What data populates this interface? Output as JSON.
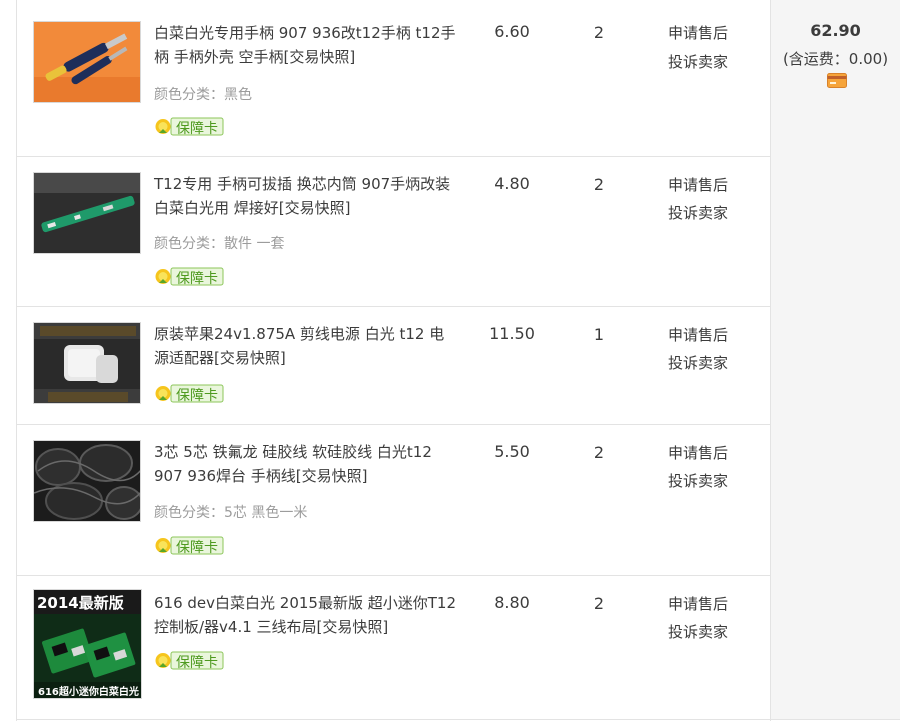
{
  "order": {
    "total": "62.90",
    "shipping": "(含运费：0.00)",
    "items": [
      {
        "title": "白菜白光专用手柄 907 936改t12手柄 t12手柄 手柄外壳 空手柄[交易快照]",
        "spec": "颜色分类：黑色",
        "price": "6.60",
        "qty": "2",
        "action_after_sale": "申请售后",
        "action_complain": "投诉卖家",
        "badge": "保障卡",
        "thumb_icon": "handle-product-icon"
      },
      {
        "title": "T12专用 手柄可拔插 换芯内筒 907手炳改装白菜白光用 焊接好[交易快照]",
        "spec": "颜色分类：散件 一套",
        "price": "4.80",
        "qty": "2",
        "action_after_sale": "申请售后",
        "action_complain": "投诉卖家",
        "badge": "保障卡",
        "thumb_icon": "circuit-tube-product-icon"
      },
      {
        "title": "原装苹果24v1.875A 剪线电源 白光 t12 电源适配器[交易快照]",
        "spec": "",
        "price": "11.50",
        "qty": "1",
        "action_after_sale": "申请售后",
        "action_complain": "投诉卖家",
        "badge": "保障卡",
        "thumb_icon": "power-adapter-product-icon"
      },
      {
        "title": "3芯 5芯 铁氟龙 硅胶线 软硅胶线 白光t12 907 936焊台 手柄线[交易快照]",
        "spec": "颜色分类：5芯 黑色一米",
        "price": "5.50",
        "qty": "2",
        "action_after_sale": "申请售后",
        "action_complain": "投诉卖家",
        "badge": "保障卡",
        "thumb_icon": "cable-rolls-product-icon"
      },
      {
        "title": "616 dev白菜白光 2015最新版 超小迷你T12控制板/器v4.1 三线布局[交易快照]",
        "spec": "",
        "price": "8.80",
        "qty": "2",
        "action_after_sale": "申请售后",
        "action_complain": "投诉卖家",
        "badge": "保障卡",
        "thumb_icon": "control-board-product-icon",
        "thumb_caption_top": "2014最新版",
        "thumb_caption_bottom": "616超小迷你白菜白光"
      }
    ]
  },
  "colors": {
    "border": "#e3e3e3",
    "text": "#3c3c3c",
    "muted": "#9c9c9c",
    "badge_green": "#5aa629",
    "total_bg": "#f5f5f5"
  }
}
